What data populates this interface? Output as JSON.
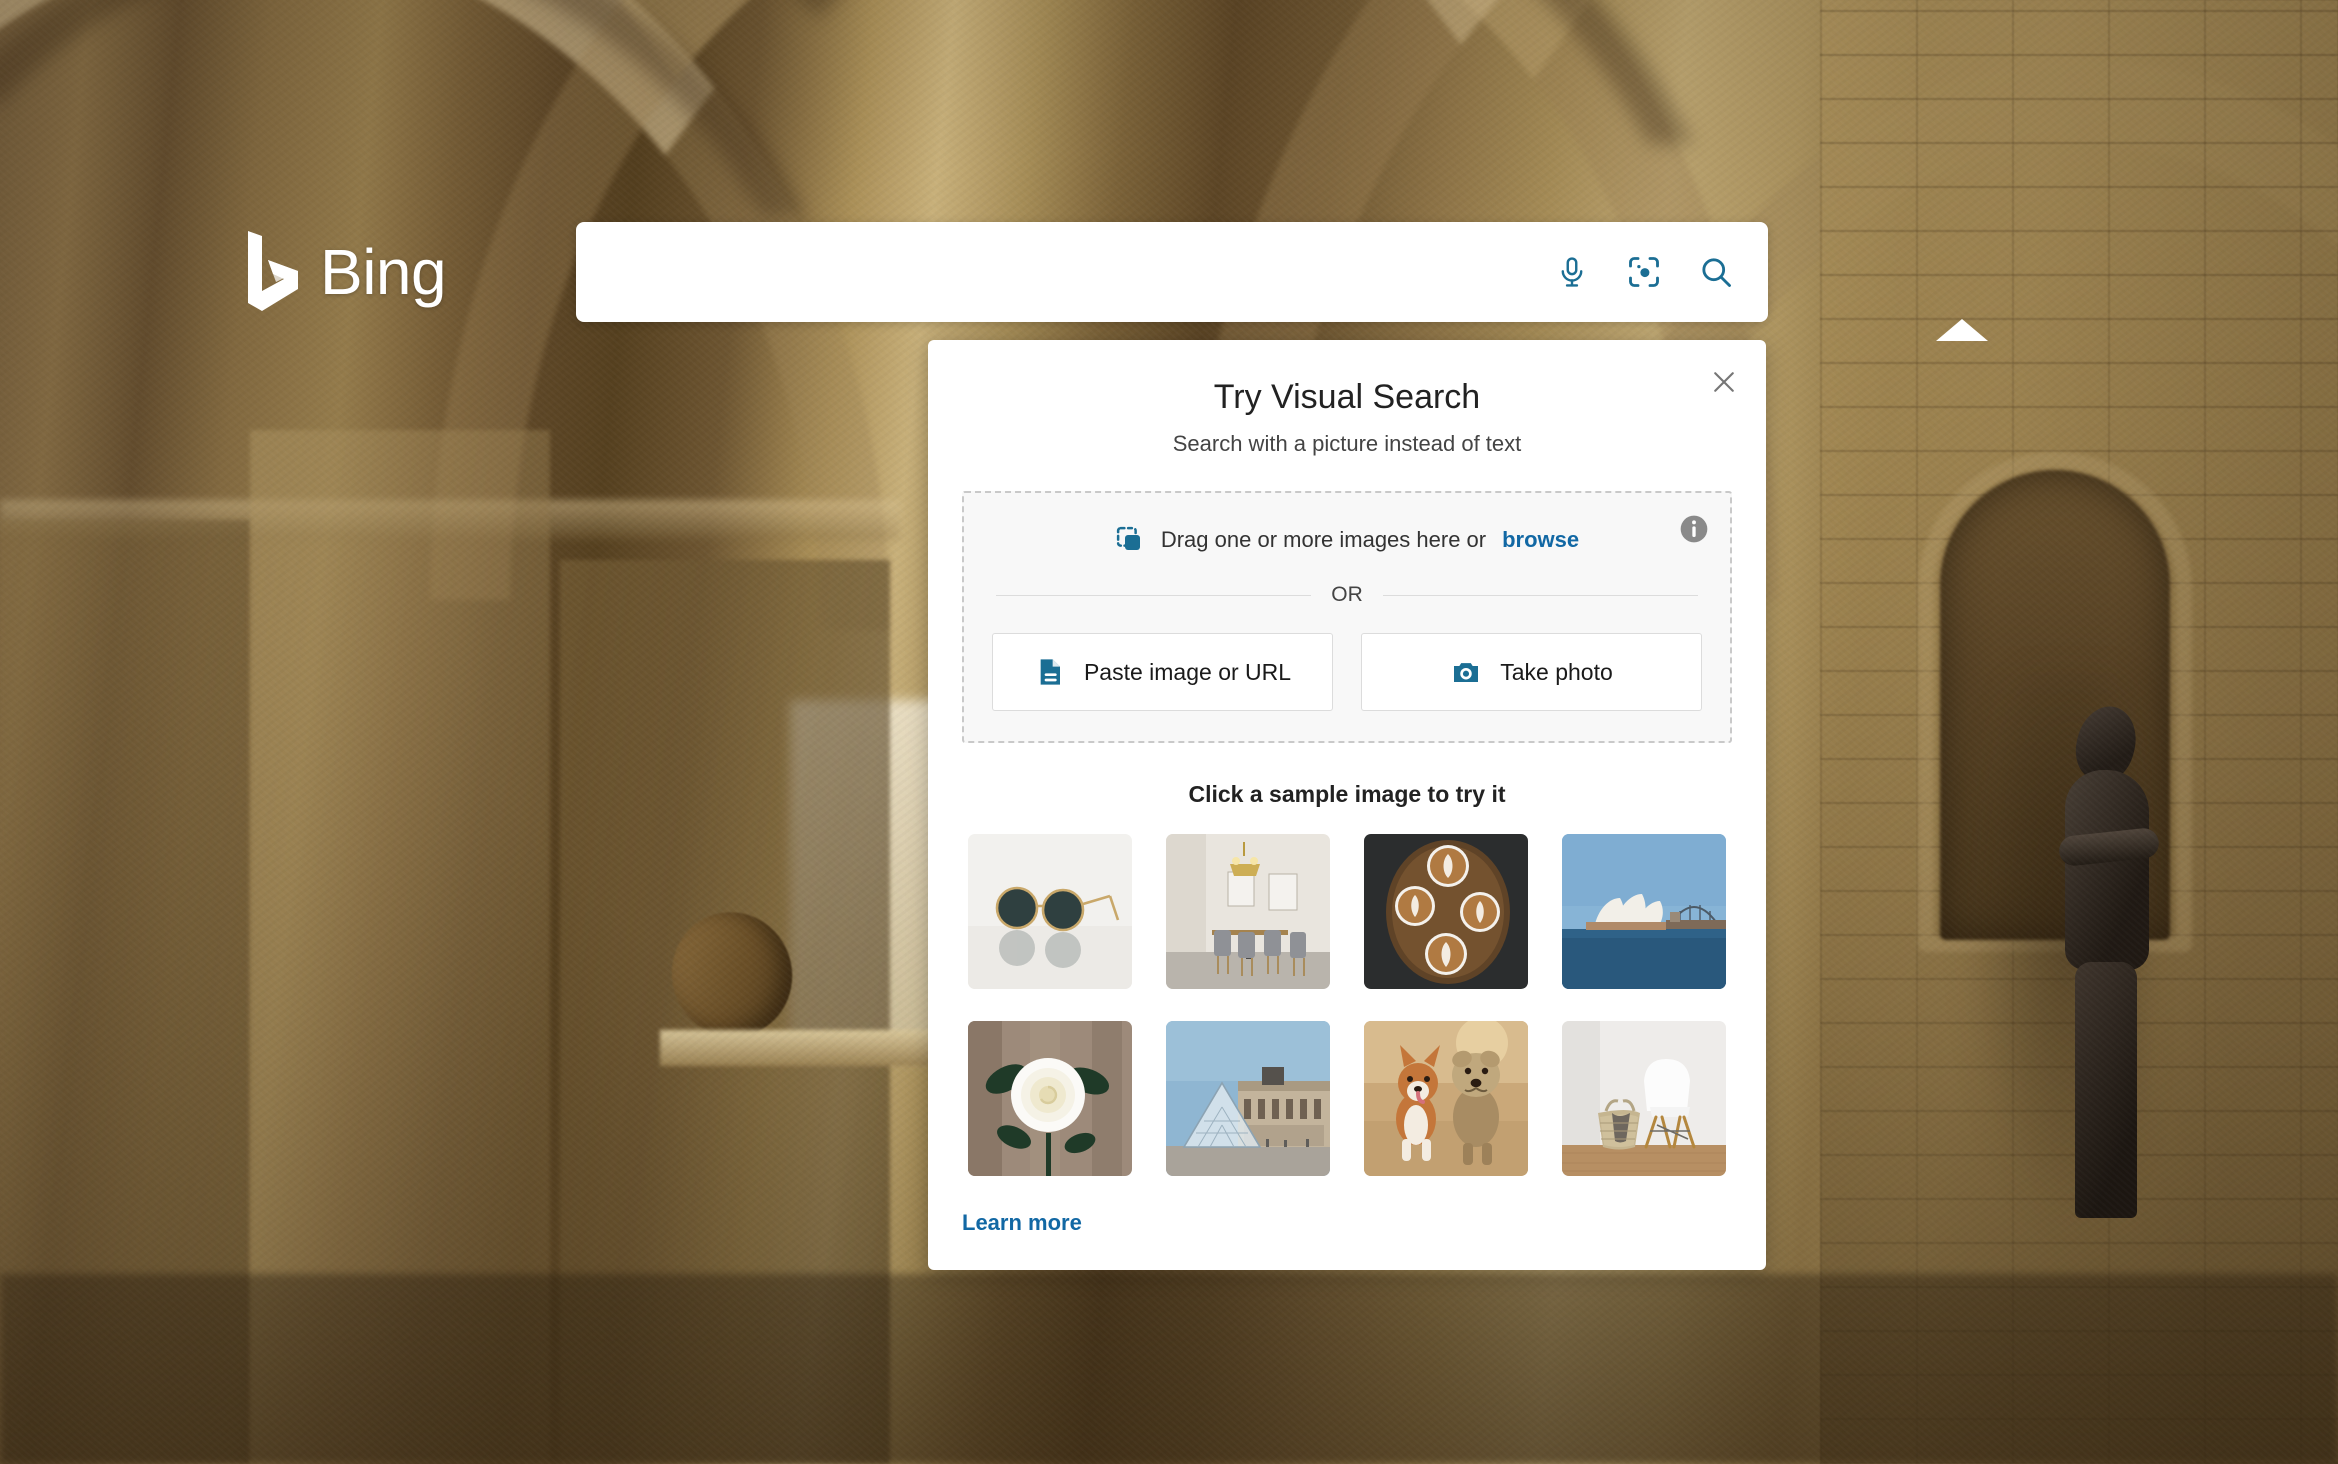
{
  "brand": {
    "name": "Bing",
    "logo_icon": "bing-logo-icon",
    "accent_color": "#1b6e94",
    "link_color": "#1268a4"
  },
  "search": {
    "value": "",
    "placeholder": "",
    "actions": [
      {
        "icon": "microphone-icon",
        "label": "Search using voice"
      },
      {
        "icon": "visual-search-icon",
        "label": "Search using an image"
      },
      {
        "icon": "magnifier-icon",
        "label": "Search"
      }
    ]
  },
  "popup": {
    "title": "Try Visual Search",
    "subtitle": "Search with a picture instead of text",
    "close_icon": "close-icon",
    "dropzone": {
      "drag_icon": "drag-image-icon",
      "text_before": "Drag one or more images here or",
      "browse_label": "browse",
      "info_icon": "info-icon"
    },
    "or_label": "OR",
    "buttons": [
      {
        "icon": "document-paste-icon",
        "label": "Paste image or URL"
      },
      {
        "icon": "camera-icon",
        "label": "Take photo"
      }
    ],
    "samples_title": "Click a sample image to try it",
    "samples": [
      {
        "name": "sunglasses",
        "alt": "Round gold-frame sunglasses on white"
      },
      {
        "name": "dining-room",
        "alt": "Dining room with chandelier and chairs"
      },
      {
        "name": "latte-art",
        "alt": "Four latte art coffee cups on dark tray"
      },
      {
        "name": "sydney-opera-house",
        "alt": "Sydney Opera House and Harbour Bridge"
      },
      {
        "name": "white-rose",
        "alt": "White rose against wooden fence"
      },
      {
        "name": "louvre-pyramid",
        "alt": "Louvre Pyramid in Paris"
      },
      {
        "name": "two-dogs",
        "alt": "Corgi and terrier running on a path"
      },
      {
        "name": "white-chair",
        "alt": "White chair with woven basket"
      }
    ],
    "learn_more_label": "Learn more"
  },
  "background": {
    "description": "Stone crypt with vaulted arches and a bronze statue"
  }
}
